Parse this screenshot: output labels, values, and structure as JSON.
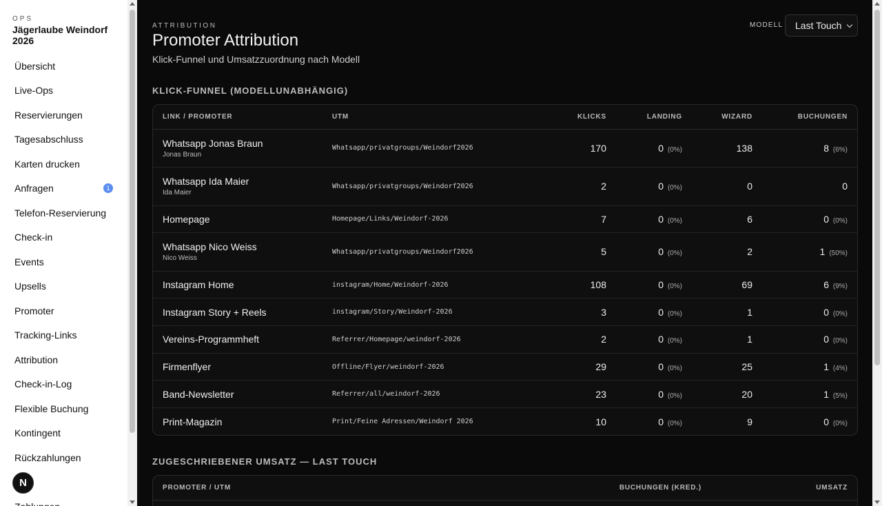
{
  "sidebar": {
    "ops_label": "OPS",
    "event_title": "Jägerlaube Weindorf 2026",
    "items": [
      {
        "label": "Übersicht"
      },
      {
        "label": "Live-Ops"
      },
      {
        "label": "Reservierungen"
      },
      {
        "label": "Tagesabschluss"
      },
      {
        "label": "Karten drucken"
      },
      {
        "label": "Anfragen",
        "badge": "1"
      },
      {
        "label": "Telefon-Reservierung"
      },
      {
        "label": "Check-in"
      },
      {
        "label": "Events"
      },
      {
        "label": "Upsells"
      },
      {
        "label": "Promoter"
      },
      {
        "label": "Tracking-Links"
      },
      {
        "label": "Attribution"
      },
      {
        "label": "Check-in-Log"
      },
      {
        "label": "Flexible Buchung"
      },
      {
        "label": "Kontingent"
      },
      {
        "label": "Rückzahlungen"
      },
      {
        "label": "n"
      },
      {
        "label": "Zahlungen"
      }
    ],
    "fab_label": "N"
  },
  "header": {
    "eyebrow": "ATTRIBUTION",
    "title": "Promoter Attribution",
    "subtitle": "Klick-Funnel und Umsatzzuordnung nach Modell"
  },
  "model": {
    "label": "MODELL",
    "selected": "Last Touch"
  },
  "funnel": {
    "heading": "KLICK-FUNNEL (MODELLUNABHÄNGIG)",
    "columns": {
      "link": "LINK / PROMOTER",
      "utm": "UTM",
      "clicks": "KLICKS",
      "landing": "LANDING",
      "wizard": "WIZARD",
      "bookings": "BUCHUNGEN"
    },
    "rows": [
      {
        "name": "Whatsapp Jonas Braun",
        "promoter": "Jonas Braun",
        "utm": "Whatsapp/privatgroups/Weindorf2026",
        "clicks": "170",
        "landing": "0",
        "landing_pct": "(0%)",
        "wizard": "138",
        "bookings": "8",
        "bookings_pct": "(6%)"
      },
      {
        "name": "Whatsapp Ida Maier",
        "promoter": "Ida Maier",
        "utm": "Whatsapp/privatgroups/Weindorf2026",
        "clicks": "2",
        "landing": "0",
        "landing_pct": "(0%)",
        "wizard": "0",
        "bookings": "0",
        "bookings_pct": ""
      },
      {
        "name": "Homepage",
        "promoter": "",
        "utm": "Homepage/Links/Weindorf-2026",
        "clicks": "7",
        "landing": "0",
        "landing_pct": "(0%)",
        "wizard": "6",
        "bookings": "0",
        "bookings_pct": "(0%)"
      },
      {
        "name": "Whatsapp Nico Weiss",
        "promoter": "Nico Weiss",
        "utm": "Whatsapp/privatgroups/Weindorf2026",
        "clicks": "5",
        "landing": "0",
        "landing_pct": "(0%)",
        "wizard": "2",
        "bookings": "1",
        "bookings_pct": "(50%)"
      },
      {
        "name": "Instagram Home",
        "promoter": "",
        "utm": "instagram/Home/Weindorf-2026",
        "clicks": "108",
        "landing": "0",
        "landing_pct": "(0%)",
        "wizard": "69",
        "bookings": "6",
        "bookings_pct": "(9%)"
      },
      {
        "name": "Instagram Story + Reels",
        "promoter": "",
        "utm": "instagram/Story/Weindorf-2026",
        "clicks": "3",
        "landing": "0",
        "landing_pct": "(0%)",
        "wizard": "1",
        "bookings": "0",
        "bookings_pct": "(0%)"
      },
      {
        "name": "Vereins-Programmheft",
        "promoter": "",
        "utm": "Referrer/Homepage/weindorf-2026",
        "clicks": "2",
        "landing": "0",
        "landing_pct": "(0%)",
        "wizard": "1",
        "bookings": "0",
        "bookings_pct": "(0%)"
      },
      {
        "name": "Firmenflyer",
        "promoter": "",
        "utm": "Offline/Flyer/weindorf-2026",
        "clicks": "29",
        "landing": "0",
        "landing_pct": "(0%)",
        "wizard": "25",
        "bookings": "1",
        "bookings_pct": "(4%)"
      },
      {
        "name": "Band-Newsletter",
        "promoter": "",
        "utm": "Referrer/all/weindorf-2026",
        "clicks": "23",
        "landing": "0",
        "landing_pct": "(0%)",
        "wizard": "20",
        "bookings": "1",
        "bookings_pct": "(5%)"
      },
      {
        "name": "Print-Magazin",
        "promoter": "",
        "utm": "Print/Feine Adressen/Weindorf 2026",
        "clicks": "10",
        "landing": "0",
        "landing_pct": "(0%)",
        "wizard": "9",
        "bookings": "0",
        "bookings_pct": "(0%)"
      }
    ]
  },
  "revenue": {
    "heading": "ZUGESCHRIEBENER UMSATZ — LAST TOUCH",
    "columns": {
      "promoter": "PROMOTER / UTM",
      "bookings": "BUCHUNGEN (KRED.)",
      "revenue": "UMSATZ"
    }
  }
}
